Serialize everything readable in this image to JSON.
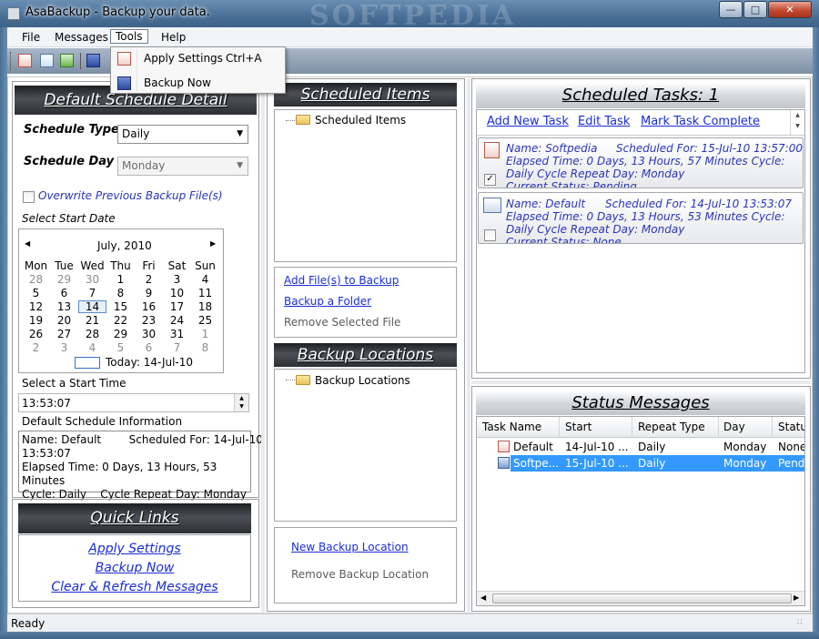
{
  "window": {
    "title": "AsaBackup - Backup your data.",
    "watermark": "SOFTPEDIA"
  },
  "menu": {
    "file": "File",
    "messages": "Messages",
    "tools": "Tools",
    "help": "Help"
  },
  "tools_menu": {
    "apply_settings": "Apply Settings",
    "apply_shortcut": "Ctrl+A",
    "backup_now": "Backup Now"
  },
  "schedule": {
    "header": "Default Schedule Detail",
    "type_label": "Schedule Type",
    "type_value": "Daily",
    "day_label": "Schedule Day",
    "day_value": "Monday",
    "overwrite_label": "Overwrite Previous Backup File(s)",
    "start_date_label": "Select Start Date",
    "start_time_label": "Select a Start Time",
    "start_time_value": "13:53:07",
    "info_label": "Default Schedule Information",
    "info_lines": [
      "Name: Default        Scheduled For: 14-Jul-10",
      "13:53:07",
      "Elapsed Time: 0 Days, 13 Hours, 53 Minutes",
      "Cycle: Daily    Cycle Repeat Day: Monday"
    ]
  },
  "calendar": {
    "month": "July, 2010",
    "prev": "◀",
    "next": "▶",
    "weekdays": [
      "Mon",
      "Tue",
      "Wed",
      "Thu",
      "Fri",
      "Sat",
      "Sun"
    ],
    "weeks": [
      [
        "28",
        "29",
        "30",
        "1",
        "2",
        "3",
        "4"
      ],
      [
        "5",
        "6",
        "7",
        "8",
        "9",
        "10",
        "11"
      ],
      [
        "12",
        "13",
        "14",
        "15",
        "16",
        "17",
        "18"
      ],
      [
        "19",
        "20",
        "21",
        "22",
        "23",
        "24",
        "25"
      ],
      [
        "26",
        "27",
        "28",
        "29",
        "30",
        "31",
        "1"
      ],
      [
        "2",
        "3",
        "4",
        "5",
        "6",
        "7",
        "8"
      ]
    ],
    "today_label": "Today: 14-Jul-10"
  },
  "quick_links": {
    "header": "Quick Links",
    "apply_settings": "Apply Settings",
    "backup_now": "Backup Now",
    "clear_refresh": "Clear & Refresh Messages"
  },
  "scheduled_items": {
    "header": "Scheduled Items",
    "tree_root": "Scheduled Items",
    "add_files": "Add File(s) to Backup",
    "backup_folder": "Backup a Folder",
    "remove_file": "Remove Selected File"
  },
  "backup_locations": {
    "header": "Backup Locations",
    "tree_root": "Backup Locations",
    "new_location": "New Backup Location",
    "remove_location": "Remove Backup Location"
  },
  "scheduled_tasks": {
    "header": "Scheduled Tasks: 1",
    "add_task": "Add New Task",
    "edit_task": "Edit Task",
    "mark_complete": "Mark Task Complete",
    "tasks": [
      {
        "line1a": "Name: Softpedia",
        "line1b": "Scheduled For: 15-Jul-10 13:57:00",
        "line2": "Elapsed Time: 0 Days, 13 Hours, 57 Minutes    Cycle:",
        "line3": "Daily    Cycle Repeat Day: Monday",
        "line4": "Current Status: Pending",
        "checked": true
      },
      {
        "line1a": "Name: Default",
        "line1b": "Scheduled For: 14-Jul-10 13:53:07",
        "line2": "Elapsed Time: 0 Days, 13 Hours, 53 Minutes    Cycle:",
        "line3": "Daily    Cycle Repeat Day: Monday",
        "line4": "Current Status: None",
        "checked": false
      }
    ]
  },
  "status_messages": {
    "header": "Status Messages",
    "columns": [
      "Task Name",
      "Start",
      "Repeat Type",
      "Day",
      "Status"
    ],
    "columns_display": [
      "Task Name",
      "Start",
      "Repeat Type",
      "Day",
      "Statu"
    ],
    "rows": [
      {
        "name": "Default",
        "start": "14-Jul-10 ...",
        "repeat": "Daily",
        "day": "Monday",
        "status": "None"
      },
      {
        "name": "Softpe...",
        "start": "15-Jul-10 ...",
        "repeat": "Daily",
        "day": "Monday",
        "status": "Pendi"
      }
    ]
  },
  "statusbar": {
    "text": "Ready"
  },
  "colors": {
    "link": "#1a2dd6",
    "selection": "#3399ff",
    "header_dark": "#2c2f33"
  }
}
